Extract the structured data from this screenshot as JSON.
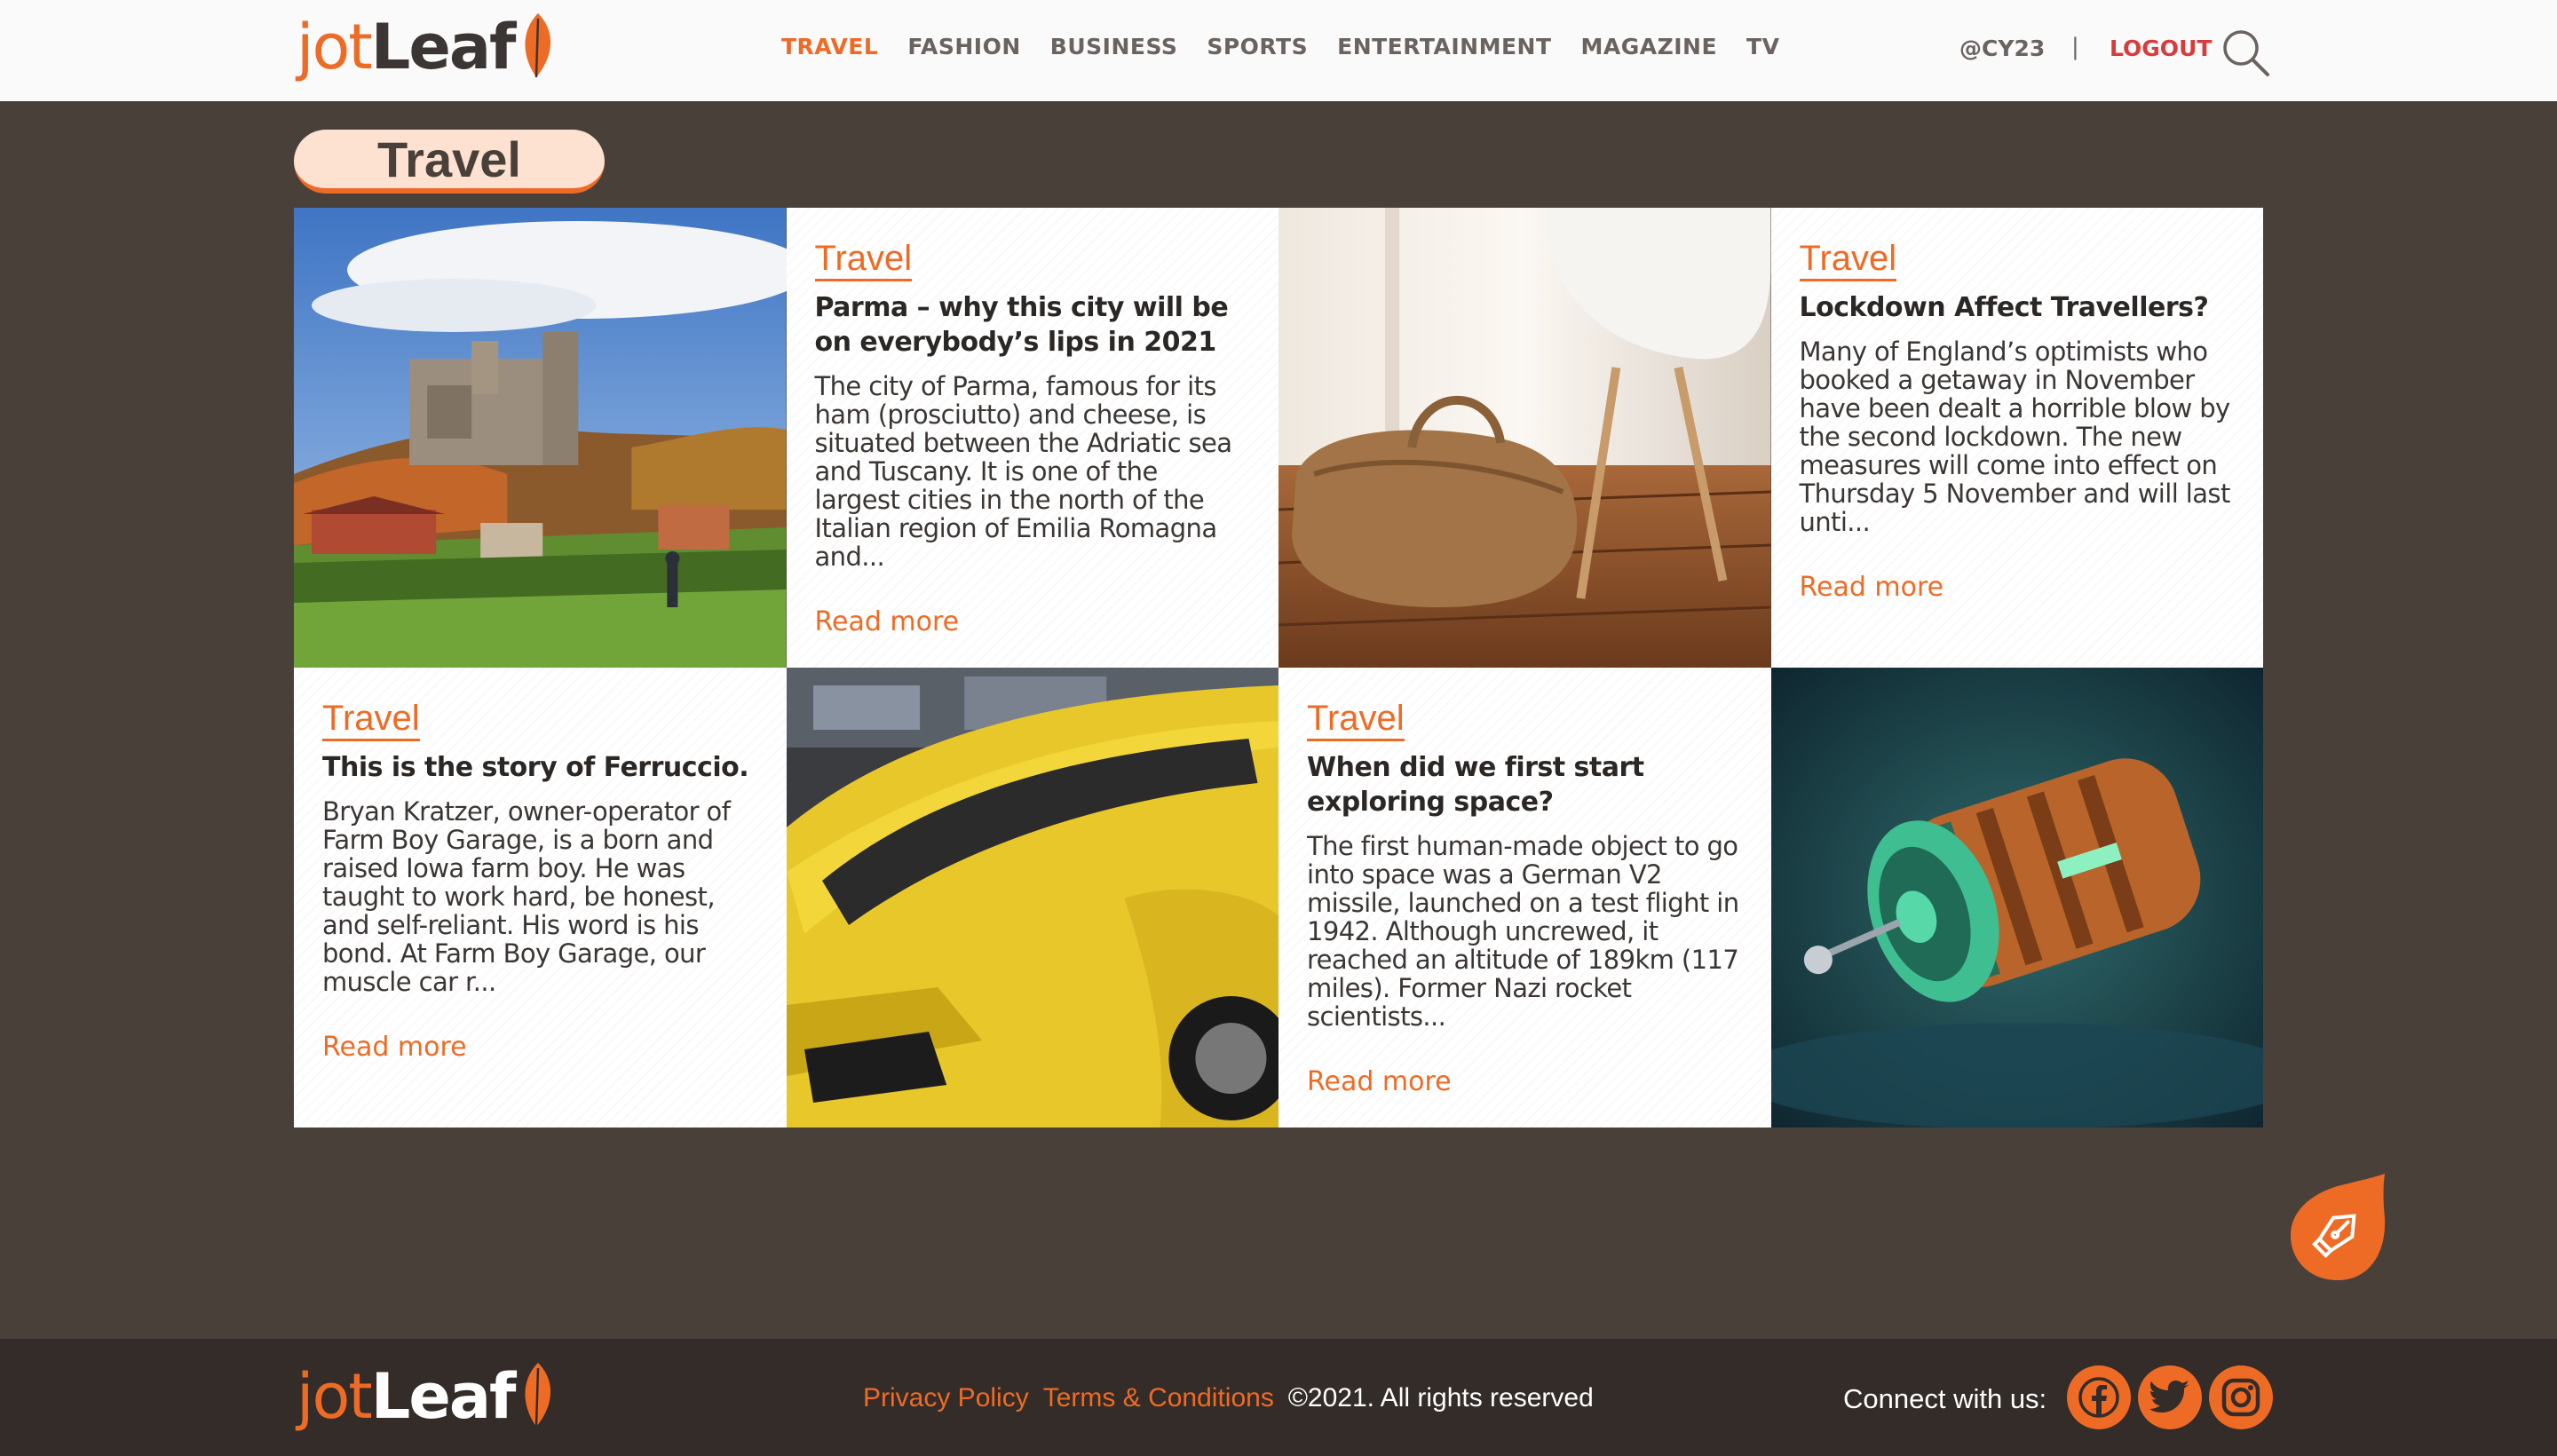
{
  "header": {
    "logo": {
      "part1": "jot",
      "part2": "Leaf"
    },
    "nav": [
      {
        "label": "TRAVEL",
        "active": true
      },
      {
        "label": "FASHION",
        "active": false
      },
      {
        "label": "BUSINESS",
        "active": false
      },
      {
        "label": "SPORTS",
        "active": false
      },
      {
        "label": "ENTERTAINMENT",
        "active": false
      },
      {
        "label": "MAGAZINE",
        "active": false
      },
      {
        "label": "TV",
        "active": false
      }
    ],
    "user": "@CY23",
    "separator": "|",
    "logout": "LOGOUT",
    "search_icon": "search-icon"
  },
  "section_title": "Travel",
  "articles": [
    {
      "category": "Travel",
      "title": "Parma – why this city will be on everybody’s lips in 2021",
      "excerpt": "The city of Parma, famous for its ham (prosciutto) and cheese, is situated between the Adriatic sea and Tuscany. It is one of the largest cities in the north of the Italian region of Emilia Romagna and...",
      "read_more": "Read more",
      "image": "castle-on-hill-image"
    },
    {
      "category": "Travel",
      "title": "Lockdown Affect Travellers?",
      "excerpt": "Many of England’s optimists who booked a getaway in November have been dealt a horrible blow by the second lockdown. The new measures will come into effect on Thursday 5 November and will last unti...",
      "read_more": "Read more",
      "image": "travel-bag-image"
    },
    {
      "category": "Travel",
      "title": "This is the story of Ferruccio.",
      "excerpt": "Bryan Kratzer, owner-operator of Farm Boy Garage, is a born and raised Iowa farm boy. He was taught to work hard, be honest, and self-reliant. His word is his bond. At Farm Boy Garage, our muscle car r...",
      "read_more": "Read more",
      "image": "yellow-car-image"
    },
    {
      "category": "Travel",
      "title": "When did we first start exploring space?",
      "excerpt": "The first human-made object to go into space was a German V2 missile, launched on a test flight in 1942. Although uncrewed, it reached an altitude of 189km (117 miles). Former Nazi rocket scientists...",
      "read_more": "Read more",
      "image": "spaceship-image"
    }
  ],
  "fab_icon": "pen-icon",
  "footer": {
    "logo": {
      "part1": "jot",
      "part2": "Leaf"
    },
    "privacy": "Privacy Policy",
    "terms": "Terms & Conditions",
    "copyright": "©2021. All rights reserved",
    "connect": "Connect with us:",
    "socials": [
      "facebook-icon",
      "twitter-icon",
      "instagram-icon"
    ]
  },
  "colors": {
    "accent": "#ee6b25",
    "background": "#4a403a",
    "footer": "#332c28",
    "logout": "#d73c3c"
  }
}
